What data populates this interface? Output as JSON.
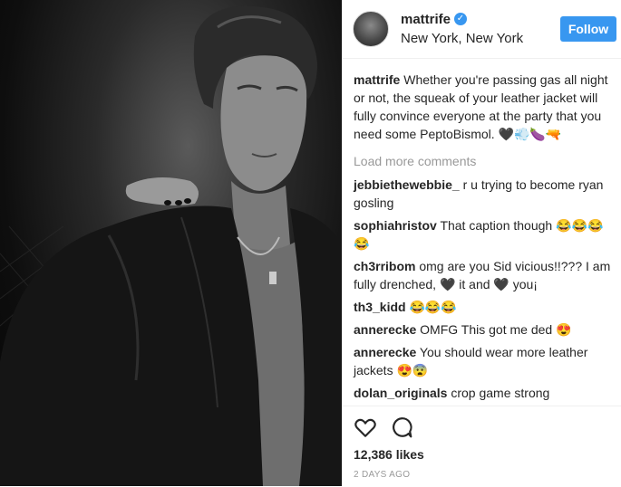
{
  "post": {
    "header": {
      "username": "mattrife",
      "location": "New York, New York",
      "follow_label": "Follow"
    },
    "caption": {
      "username": "mattrife",
      "text": "Whether you're passing gas all night or not, the squeak of your leather jacket will fully convince everyone at the party that you need some PeptoBismol. 🖤💨🍆🔫"
    },
    "load_more": "Load more comments",
    "comments": [
      {
        "user": "jebbiethewebbie_",
        "text": "r u trying to become ryan gosling"
      },
      {
        "user": "sophiahristov",
        "text": "That caption though 😂😂😂😂"
      },
      {
        "user": "ch3rribom",
        "text": "omg are you Sid vicious!!??? I am fully drenched, 🖤 it and 🖤 you¡"
      },
      {
        "user": "th3_kidd",
        "text": "😂😂😂"
      },
      {
        "user": "annerecke",
        "text": "OMFG This got me ded 😍"
      },
      {
        "user": "annerecke",
        "text": "You should wear more leather jackets 😍😨"
      },
      {
        "user": "dolan_originals",
        "text": "crop game strong"
      }
    ],
    "likes": "12,386 likes",
    "time": "2 DAYS AGO"
  },
  "colors": {
    "accent": "#3897f0",
    "text": "#262626",
    "muted": "#999999"
  },
  "icons": [
    "verified-badge-icon",
    "heart-icon",
    "comment-icon"
  ]
}
